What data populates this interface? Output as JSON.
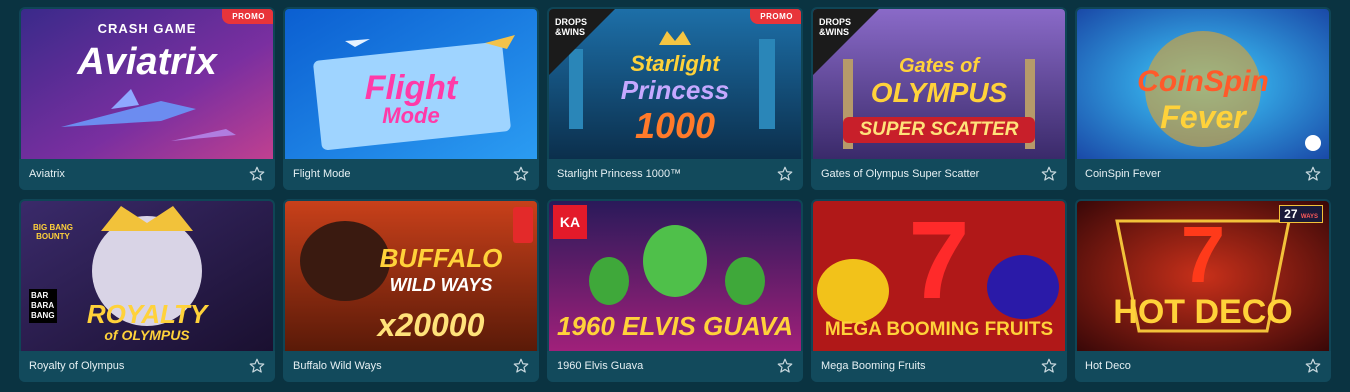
{
  "games": [
    {
      "title": "Aviatrix",
      "promo": "PROMO",
      "art": {
        "line1": "CRASH GAME",
        "line2": "Aviatrix"
      }
    },
    {
      "title": "Flight Mode",
      "art": {
        "line1": "Flight",
        "line2": "Mode"
      }
    },
    {
      "title": "Starlight Princess 1000™",
      "promo": "PROMO",
      "badge": [
        "DROPS",
        "&WINS"
      ],
      "art": {
        "line1": "Starlight",
        "line2": "Princess",
        "line3": "1000"
      }
    },
    {
      "title": "Gates of Olympus Super Scatter",
      "badge": [
        "DROPS",
        "&WINS"
      ],
      "art": {
        "line1": "Gates of",
        "line2": "OLYMPUS",
        "line3": "SUPER SCATTER"
      }
    },
    {
      "title": "CoinSpin Fever",
      "art": {
        "line1": "CoinSpin",
        "line2": "Fever"
      }
    },
    {
      "title": "Royalty of Olympus",
      "art": {
        "line1": "ROYALTY",
        "line2": "of OLYMPUS",
        "badge": "BIG BANG BOUNTY",
        "studio": [
          "BAR",
          "BARA",
          "BANG"
        ]
      }
    },
    {
      "title": "Buffalo Wild Ways",
      "art": {
        "line1": "BUFFALO",
        "line2": "WILD WAYS",
        "line3": "x20000"
      }
    },
    {
      "title": "1960 Elvis Guava",
      "art": {
        "line1": "1960 ELVIS GUAVA",
        "studio": "KA"
      }
    },
    {
      "title": "Mega Booming Fruits",
      "art": {
        "line1": "7",
        "line2": "MEGA BOOMING FRUITS"
      }
    },
    {
      "title": "Hot Deco",
      "art": {
        "line1": "7",
        "line2": "HOT DECO",
        "ways": "27",
        "ways_label": "WAYS"
      }
    }
  ],
  "colors": {
    "background": "#0a3341",
    "card": "#0f4556",
    "promo": "#e8343a",
    "text": "#e6f0f3"
  },
  "icons": {
    "favorite": "star-outline-icon"
  }
}
